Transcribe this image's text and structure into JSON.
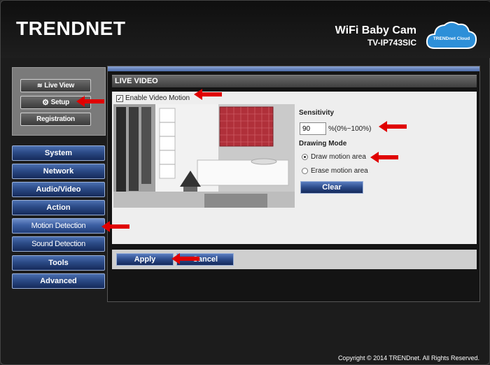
{
  "header": {
    "logo": "TRENDNET",
    "product_name": "WiFi Baby Cam",
    "model": "TV-IP743SIC",
    "cloud_label": "TRENDnet Cloud"
  },
  "sidebar": {
    "top_buttons": [
      {
        "label": "Live View",
        "icon": "camera-wave-icon"
      },
      {
        "label": "Setup",
        "icon": "gear-icon"
      },
      {
        "label": "Registration",
        "icon": ""
      }
    ],
    "nav": [
      {
        "label": "System"
      },
      {
        "label": "Network"
      },
      {
        "label": "Audio/Video"
      },
      {
        "label": "Action"
      },
      {
        "label": "Motion Detection"
      },
      {
        "label": "Sound Detection"
      },
      {
        "label": "Tools"
      },
      {
        "label": "Advanced"
      }
    ]
  },
  "main": {
    "section_title": "LIVE VIDEO",
    "enable_label": "Enable Video Motion",
    "enable_checked": true,
    "sensitivity_label": "Sensitivity",
    "sensitivity_value": "90",
    "sensitivity_unit": "%(0%~100%)",
    "drawing_mode_label": "Drawing Mode",
    "radio_options": [
      {
        "label": "Draw motion area",
        "selected": true
      },
      {
        "label": "Erase motion area",
        "selected": false
      }
    ],
    "clear_label": "Clear",
    "apply_label": "Apply",
    "cancel_label": "Cancel"
  },
  "footer": {
    "copyright": "Copyright © 2014 TRENDnet. All Rights Reserved."
  },
  "colors": {
    "nav_blue": "#2b4a86",
    "annotation_red": "#e00000",
    "motion_area": "#b0303a"
  }
}
